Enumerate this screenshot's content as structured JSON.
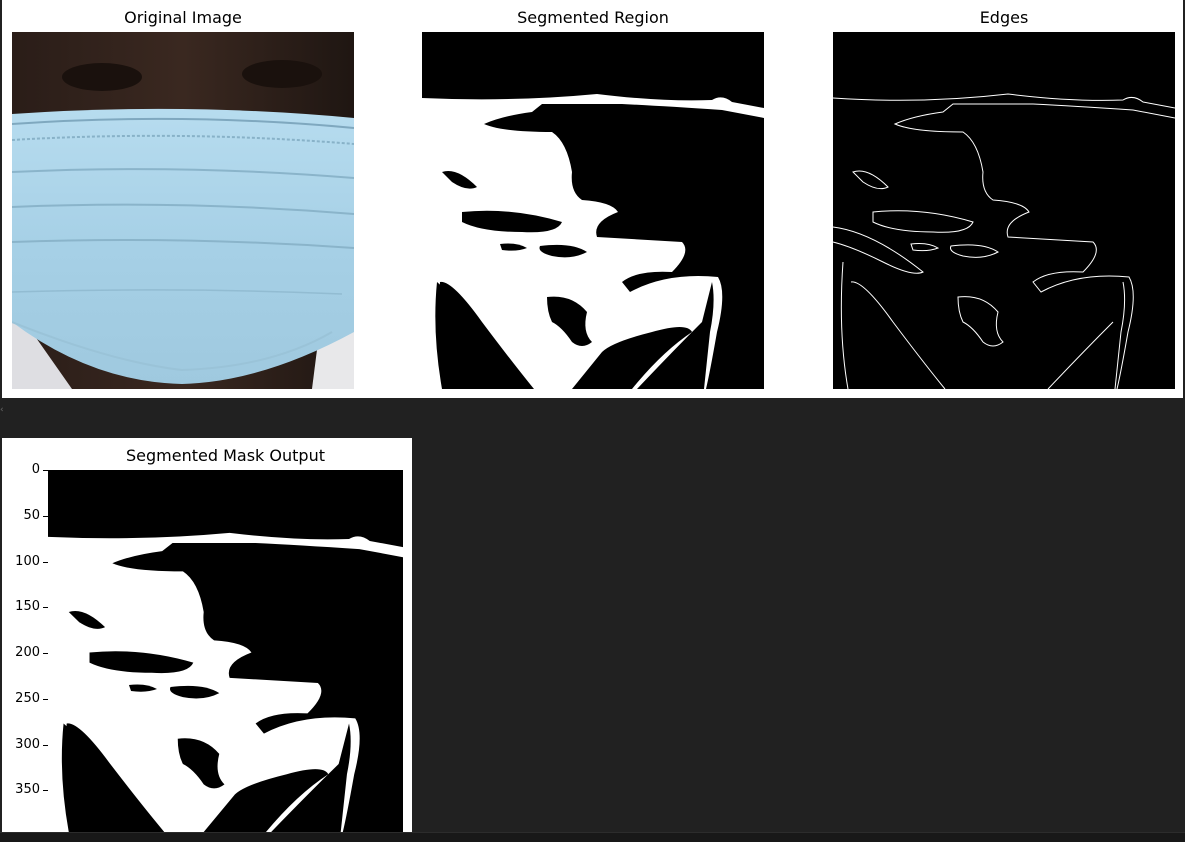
{
  "figure1": {
    "titles": {
      "original": "Original Image",
      "segmented": "Segmented Region",
      "edges": "Edges"
    }
  },
  "figure2": {
    "title": "Segmented Mask Output",
    "yticks": [
      "0",
      "50",
      "100",
      "150",
      "200",
      "250",
      "300",
      "350"
    ]
  },
  "colors": {
    "notebook_bg": "#212121",
    "mask_fg": "#ffffff",
    "mask_bg": "#000000",
    "mask_blue": "#a9d3ea"
  }
}
